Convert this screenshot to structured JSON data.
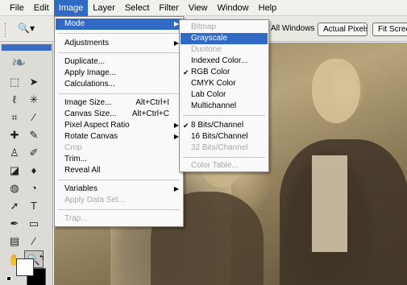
{
  "menubar": {
    "items": [
      "File",
      "Edit",
      "Image",
      "Layer",
      "Select",
      "Filter",
      "View",
      "Window",
      "Help"
    ],
    "active_index": 2
  },
  "options_bar": {
    "tool_icon": "zoom-tool-icon",
    "all_windows_label": "All Windows",
    "actual_pixels_label": "Actual Pixels",
    "fit_screen_label": "Fit Scree"
  },
  "image_menu": {
    "mode": "Mode",
    "adjustments": "Adjustments",
    "duplicate": "Duplicate...",
    "apply_image": "Apply Image...",
    "calculations": "Calculations...",
    "image_size": "Image Size...",
    "image_size_shortcut": "Alt+Ctrl+I",
    "canvas_size": "Canvas Size...",
    "canvas_size_shortcut": "Alt+Ctrl+C",
    "pixel_aspect_ratio": "Pixel Aspect Ratio",
    "rotate_canvas": "Rotate Canvas",
    "crop": "Crop",
    "trim": "Trim...",
    "reveal_all": "Reveal All",
    "variables": "Variables",
    "apply_data_set": "Apply Data Set...",
    "trap": "Trap..."
  },
  "mode_submenu": {
    "bitmap": "Bitmap",
    "grayscale": "Grayscale",
    "duotone": "Duotone",
    "indexed_color": "Indexed Color...",
    "rgb_color": "RGB Color",
    "cmyk_color": "CMYK Color",
    "lab_color": "Lab Color",
    "multichannel": "Multichannel",
    "bits8": "8 Bits/Channel",
    "bits16": "16 Bits/Channel",
    "bits32": "32 Bits/Channel",
    "color_table": "Color Table...",
    "checked": [
      "RGB Color",
      "8 Bits/Channel"
    ]
  },
  "colors": {
    "highlight": "#316ac5",
    "disabled_text": "#a7a7a7"
  }
}
